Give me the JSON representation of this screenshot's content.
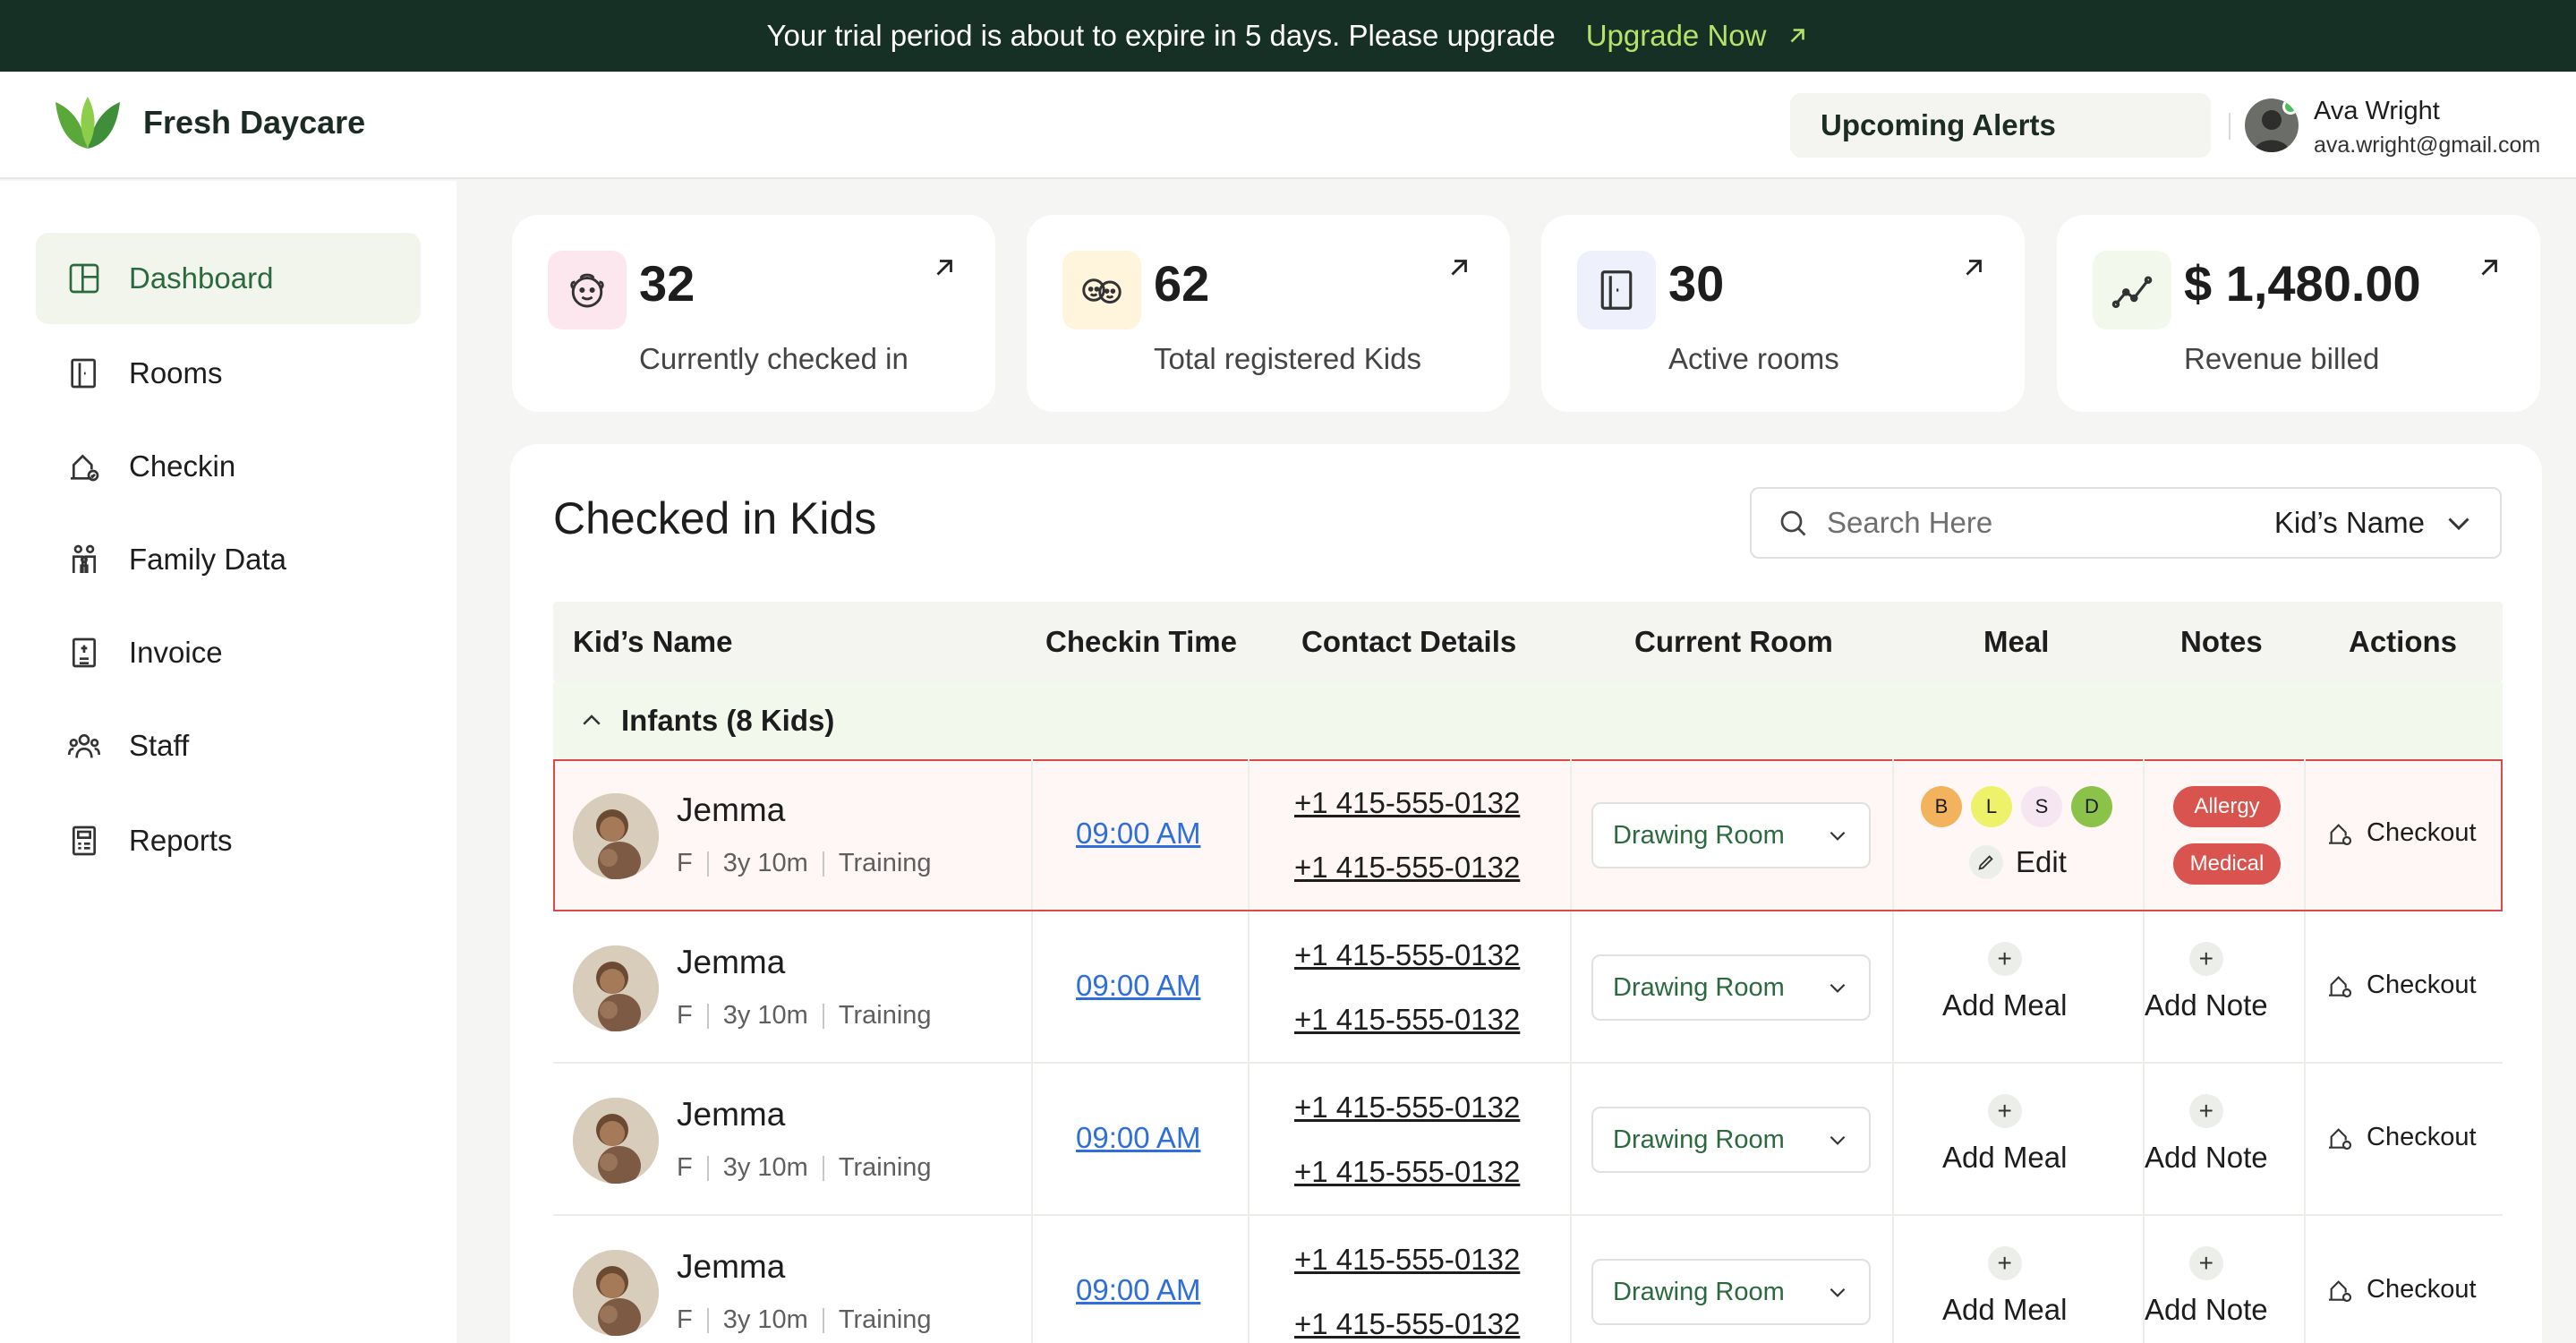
{
  "trial_bar": {
    "message": "Your trial period is about to expire in 5 days. Please upgrade",
    "cta": "Upgrade Now"
  },
  "header": {
    "brand": "Fresh Daycare",
    "alerts_button": "Upcoming Alerts",
    "user": {
      "name": "Ava Wright",
      "email": "ava.wright@gmail.com"
    }
  },
  "sidebar": {
    "items": [
      {
        "label": "Dashboard",
        "icon": "dashboard-icon",
        "active": true
      },
      {
        "label": "Rooms",
        "icon": "door-icon"
      },
      {
        "label": "Checkin",
        "icon": "checkin-icon"
      },
      {
        "label": "Family Data",
        "icon": "family-icon"
      },
      {
        "label": "Invoice",
        "icon": "invoice-icon"
      },
      {
        "label": "Staff",
        "icon": "staff-icon"
      },
      {
        "label": "Reports",
        "icon": "report-icon"
      }
    ]
  },
  "stats": [
    {
      "value": "32",
      "label": "Currently checked in",
      "icon": "baby-face-icon",
      "icon_bg": "#fde7ee"
    },
    {
      "value": "62",
      "label": "Total registered Kids",
      "icon": "kids-faces-icon",
      "icon_bg": "#fff4dc"
    },
    {
      "value": "30",
      "label": "Active rooms",
      "icon": "door-icon",
      "icon_bg": "#eef0fb"
    },
    {
      "value": "$ 1,480.00",
      "label": "Revenue billed",
      "icon": "trend-line-icon",
      "icon_bg": "#f3f8ec"
    }
  ],
  "panel": {
    "title": "Checked in Kids",
    "search_placeholder": "Search Here",
    "search_filter": "Kid’s Name"
  },
  "table": {
    "columns": [
      "Kid’s Name",
      "Checkin Time",
      "Contact Details",
      "Current Room",
      "Meal",
      "Notes",
      "Actions"
    ],
    "group": "Infants (8 Kids)",
    "rows": [
      {
        "name": "Jemma",
        "gender": "F",
        "age": "3y 10m",
        "program": "Training",
        "checkin": "09:00 AM",
        "phone1": "+1 415-555-0132",
        "phone2": "+1 415-555-0132",
        "room": "Drawing Room",
        "meal_badges": [
          "B",
          "L",
          "S",
          "D"
        ],
        "meal_action": "Edit",
        "notes": [
          "Allergy",
          "Medical"
        ],
        "action": "Checkout",
        "selected": true
      },
      {
        "name": "Jemma",
        "gender": "F",
        "age": "3y 10m",
        "program": "Training",
        "checkin": "09:00 AM",
        "phone1": "+1 415-555-0132",
        "phone2": "+1 415-555-0132",
        "room": "Drawing Room",
        "meal_action": "Add Meal",
        "note_action": "Add Note",
        "action": "Checkout"
      },
      {
        "name": "Jemma",
        "gender": "F",
        "age": "3y 10m",
        "program": "Training",
        "checkin": "09:00 AM",
        "phone1": "+1 415-555-0132",
        "phone2": "+1 415-555-0132",
        "room": "Drawing Room",
        "meal_action": "Add Meal",
        "note_action": "Add Note",
        "action": "Checkout"
      },
      {
        "name": "Jemma",
        "gender": "F",
        "age": "3y 10m",
        "program": "Training",
        "checkin": "09:00 AM",
        "phone1": "+1 415-555-0132",
        "phone2": "+1 415-555-0132",
        "room": "Drawing Room",
        "meal_action": "Add Meal",
        "note_action": "Add Note",
        "action": "Checkout"
      }
    ]
  },
  "colors": {
    "brand_dark": "#163026",
    "accent_green": "#2b6a3e",
    "upgrade": "#b6e26a",
    "meal_B": "#f3b35c",
    "meal_L": "#eef26a",
    "meal_S": "#f6e6f2",
    "meal_D": "#8bc34a",
    "note_badge": "#d9534f",
    "link": "#2f6fd9"
  }
}
